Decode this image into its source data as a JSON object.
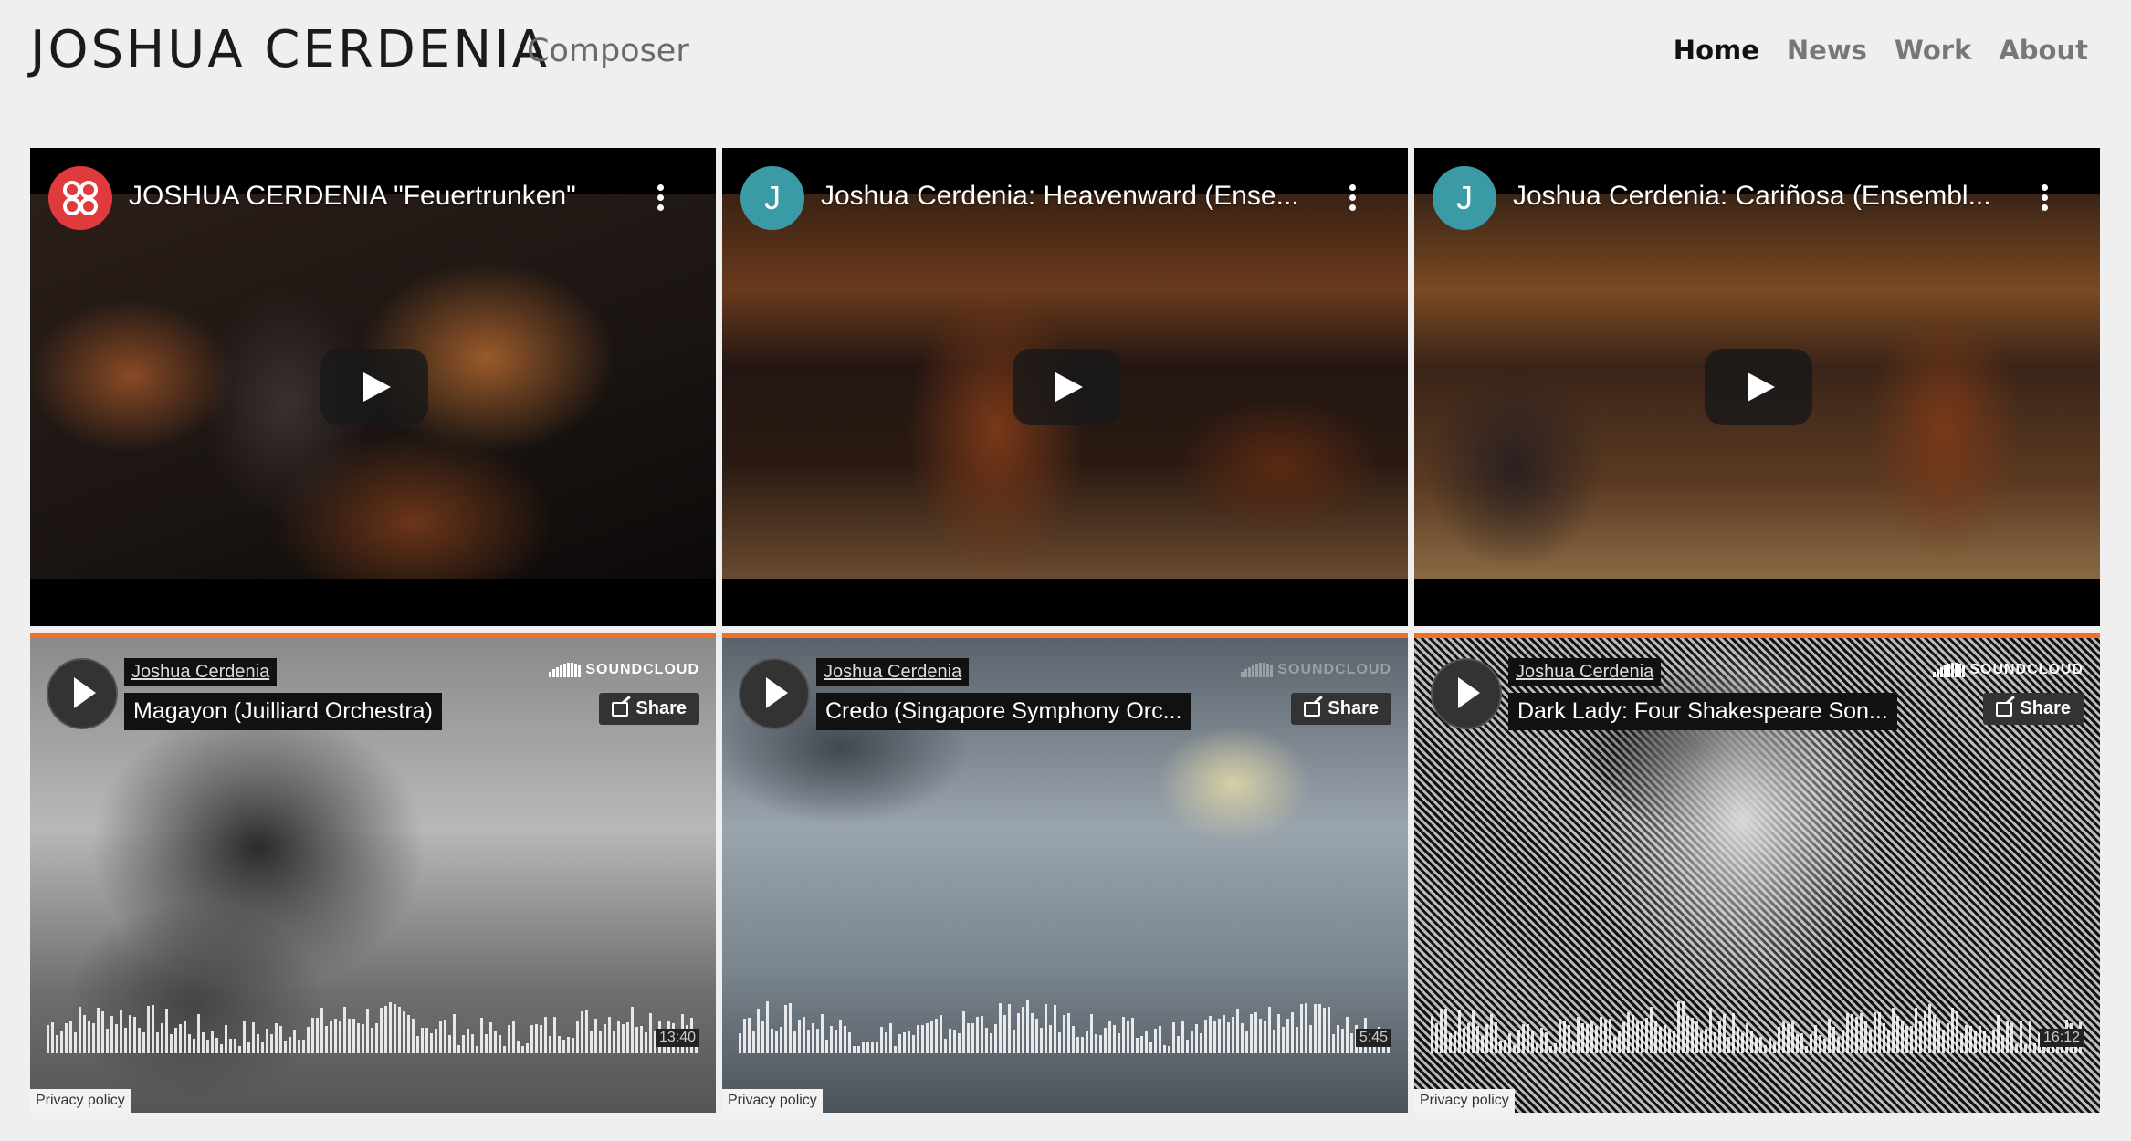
{
  "header": {
    "site_title": "JOSHUA CERDENIA",
    "site_subtitle": "Composer",
    "nav": [
      {
        "label": "Home",
        "active": true
      },
      {
        "label": "News",
        "active": false
      },
      {
        "label": "Work",
        "active": false
      },
      {
        "label": "About",
        "active": false
      }
    ]
  },
  "videos": [
    {
      "title": "JOSHUA CERDENIA \"Feuertrunken\"",
      "avatar": "",
      "avatar_color": "#e03a3e"
    },
    {
      "title": "Joshua Cerdenia: Heavenward (Ense...",
      "avatar": "J",
      "avatar_color": "#3a9aa6"
    },
    {
      "title": "Joshua Cerdenia: Cariñosa (Ensembl...",
      "avatar": "J",
      "avatar_color": "#3a9aa6"
    }
  ],
  "soundcloud": {
    "brand": "SOUNDCLOUD",
    "share_label": "Share",
    "privacy_label": "Privacy policy",
    "accent": "#f26f23",
    "tracks": [
      {
        "user": "Joshua Cerdenia",
        "title": "Magayon (Juilliard Orchestra)",
        "duration": "13:40"
      },
      {
        "user": "Joshua Cerdenia",
        "title": "Credo (Singapore Symphony Orc...",
        "duration": "5:45"
      },
      {
        "user": "Joshua Cerdenia",
        "title": "Dark Lady: Four Shakespeare Son...",
        "duration": "16:12"
      }
    ]
  }
}
